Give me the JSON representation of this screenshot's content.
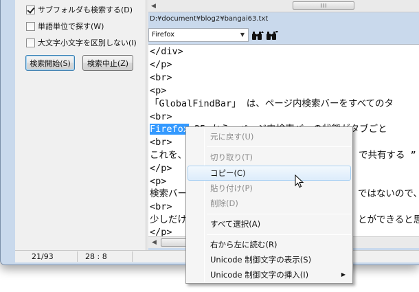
{
  "options": {
    "subfolder_label": "サブフォルダも検索する(D)",
    "subfolder_checked": true,
    "word_label": "単語単位で探す(W)",
    "word_checked": false,
    "case_label": "大文字小文字を区別しない(I)",
    "case_checked": false
  },
  "buttons": {
    "start": "検索開始(S)",
    "stop": "検索中止(Z)"
  },
  "file_path": "D:¥document¥blog2¥bangai63.txt",
  "search": {
    "value": "Firefox"
  },
  "icons": {
    "find_prev": "binoculars-up-icon",
    "find_next": "binoculars-down-icon"
  },
  "editor": {
    "lines": [
      "</div>",
      "</p>",
      "<br>",
      "<p>",
      "「GlobalFindBar」 は、ページ内検索バーをすべてのタ",
      "<br>",
      "",
      "<br>",
      "これを、",
      "</p>",
      "<p>",
      "検索バー",
      "<br>",
      "少しだけ",
      "</p>"
    ],
    "selected_word": "Firefox",
    "line7_rest": " 25 から、ページ内検索バーの状態がタブごと",
    "line9_tail": "で共有する ”",
    "line12_tail": "ではないので、",
    "line14_tail": "とができると思"
  },
  "status": {
    "line_info": "21/93",
    "cursor_info": "28 :  8"
  },
  "context_menu": {
    "items": [
      {
        "label": "元に戻す(U)",
        "enabled": false
      },
      {
        "label": "切り取り(T)",
        "enabled": false
      },
      {
        "label": "コピー(C)",
        "enabled": true
      },
      {
        "label": "貼り付け(P)",
        "enabled": false
      },
      {
        "label": "削除(D)",
        "enabled": false
      },
      {
        "label": "すべて選択(A)",
        "enabled": true
      },
      {
        "label": "右から左に読む(R)",
        "enabled": true
      },
      {
        "label": "Unicode 制御文字の表示(S)",
        "enabled": true
      },
      {
        "label": "Unicode 制御文字の挿入(I)",
        "enabled": true
      }
    ]
  }
}
